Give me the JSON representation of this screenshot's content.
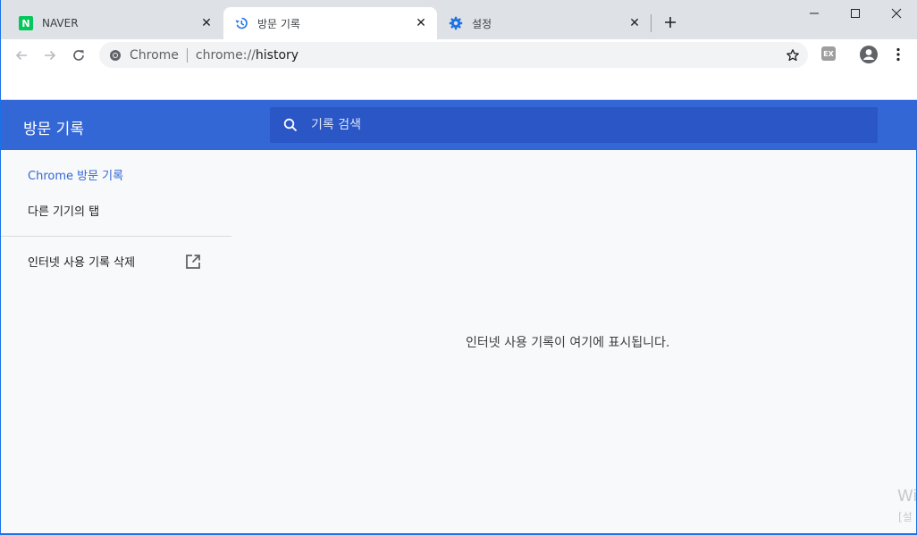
{
  "tabs": [
    {
      "title": "NAVER",
      "favicon": "naver-icon",
      "favicon_label": "N",
      "active": false
    },
    {
      "title": "방문 기록",
      "favicon": "history-icon",
      "active": true
    },
    {
      "title": "설정",
      "favicon": "gear-icon",
      "active": false
    }
  ],
  "toolbar": {
    "site_label": "Chrome",
    "url_scheme": "chrome://",
    "url_path": "history",
    "extension_label": "EX"
  },
  "history": {
    "title": "방문 기록",
    "search_placeholder": "기록 검색",
    "sidebar": {
      "chrome_history_prefix": "Chrome",
      "chrome_history_suffix": " 방문 기록",
      "other_devices": "다른 기기의 탭",
      "clear_data": "인터넷 사용 기록 삭제"
    },
    "empty_message": "인터넷 사용 기록이 여기에 표시됩니다."
  },
  "watermark": {
    "line1": "Wi",
    "line2": "[설"
  },
  "colors": {
    "accent": "#3367d6",
    "search_bg": "#2a56c6",
    "naver_green": "#03c75a"
  }
}
